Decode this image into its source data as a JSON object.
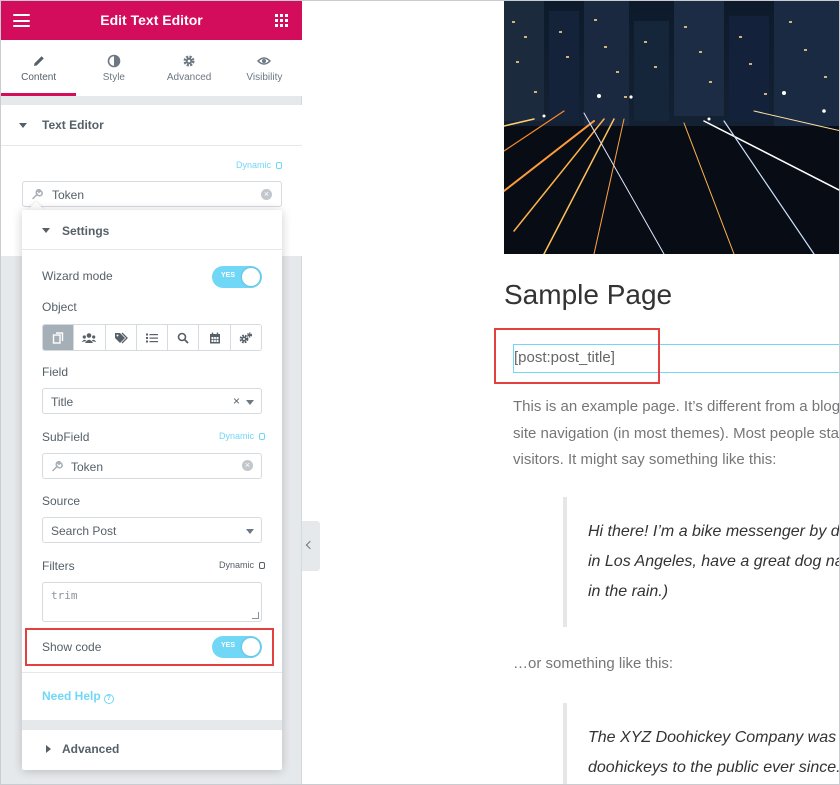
{
  "panel": {
    "header_title": "Edit Text Editor",
    "tabs": [
      {
        "label": "Content",
        "icon": "pencil-icon",
        "active": true
      },
      {
        "label": "Style",
        "icon": "half-circle-icon"
      },
      {
        "label": "Advanced",
        "icon": "gear-icon"
      },
      {
        "label": "Visibility",
        "icon": "eye-icon"
      }
    ],
    "section_title": "Text Editor",
    "dynamic_label": "Dynamic",
    "token_value": "Token",
    "popover": {
      "title": "Settings",
      "wizard_mode_label": "Wizard mode",
      "wizard_mode_state": "YES",
      "object_label": "Object",
      "object_buttons": [
        "posts-icon",
        "users-icon",
        "tags-icon",
        "list-icon",
        "search-icon",
        "calendar-icon",
        "cogs-icon"
      ],
      "field_label": "Field",
      "field_value": "Title",
      "field_clear": "×",
      "subfield_label": "SubField",
      "subfield_dynamic": "Dynamic",
      "subfield_value": "Token",
      "source_label": "Source",
      "source_value": "Search Post",
      "filters_label": "Filters",
      "filters_dynamic": "Dynamic",
      "filters_placeholder": "trim",
      "show_code_label": "Show code",
      "show_code_state": "YES",
      "help_label": "Need Help",
      "help_icon": "?",
      "advanced_label": "Advanced"
    }
  },
  "preview": {
    "page_title": "Sample Page",
    "post_title_token": "[post:post_title]",
    "paragraph_lines": [
      "This is an example page. It’s different from a blog",
      "site navigation (in most themes). Most people sta",
      "visitors. It might say something like this:"
    ],
    "quote1_lines": [
      "Hi there! I’m a bike messenger by da",
      "in Los Angeles, have a great dog na",
      "in the rain.)"
    ],
    "between_text": "…or something like this:",
    "quote2_lines": [
      "The XYZ Doohickey Company was f",
      "doohickeys to the public ever since."
    ]
  },
  "colors": {
    "brand": "#d30c5c",
    "accent": "#71d7f7",
    "highlight": "#e34040"
  }
}
